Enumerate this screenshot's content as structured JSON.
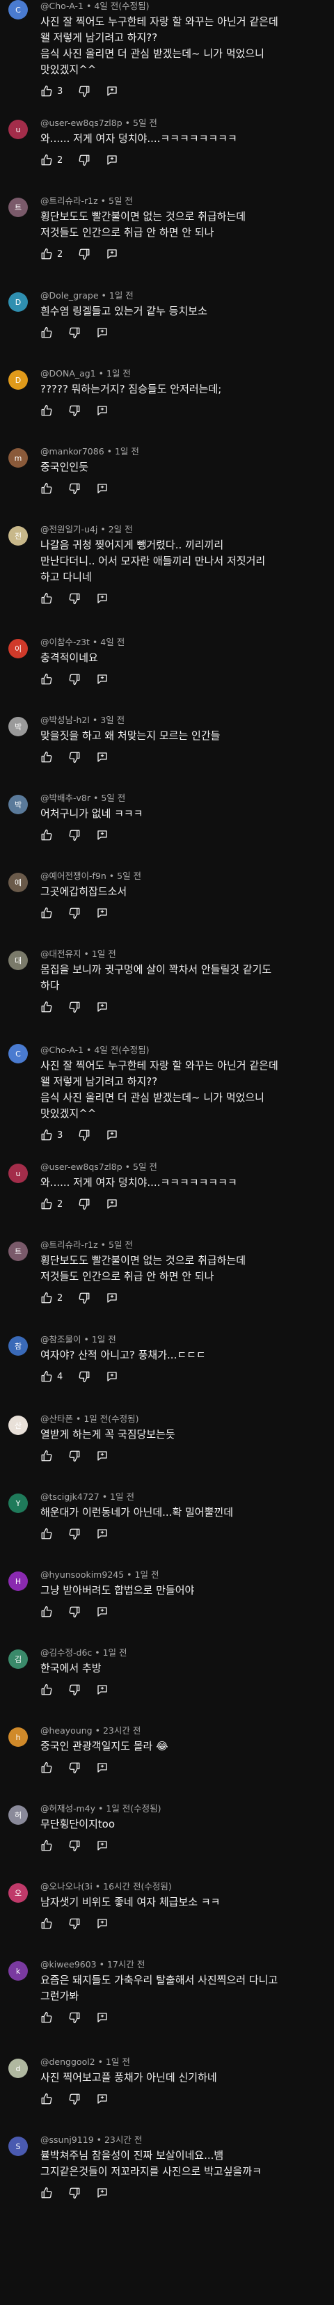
{
  "comments": [
    {
      "author": "@Cho-A-1",
      "time": "4일 전(수정됨)",
      "text": "사진 잘 찍어도 누구한테 자랑 할 와꾸는 아닌거 같은데\n왤 저렇게 남기려고 하지??\n음식 사진 올리면 더 관심 받겠는데~ 니가 먹었으니\n맛있겠지^^",
      "likes": "3",
      "avatar": {
        "color": "#4a7bd0",
        "glyph": "C"
      }
    },
    {
      "author": "@user-ew8qs7zl8p",
      "time": "5일 전",
      "text": "와...... 저게 여자 덩치야....ㅋㅋㅋㅋㅋㅋㅋㅋ",
      "likes": "2",
      "avatar": {
        "color": "#a32d4a",
        "glyph": "u"
      }
    },
    {
      "author": "@트리슈라-r1z",
      "time": "5일 전",
      "text": "횡단보도도 빨간불이면 없는 것으로 취급하는데\n저것들도 인간으로 취급 안 하면 안 되나",
      "likes": "2",
      "avatar": {
        "color": "#7a5a6a",
        "glyph": "트"
      }
    },
    {
      "author": "@Dole_grape",
      "time": "1일 전",
      "text": "흰수염 링겔들고 있는거 같누 등치보소",
      "likes": "",
      "avatar": {
        "color": "#2f8fb0",
        "glyph": "D"
      }
    },
    {
      "author": "@DONA_ag1",
      "time": "1일 전",
      "text": "????? 뭐하는거지? 짐승들도 안저러는데;",
      "likes": "",
      "avatar": {
        "color": "#e09a1a",
        "glyph": "D"
      }
    },
    {
      "author": "@mankor7086",
      "time": "1일 전",
      "text": "중국인인듯",
      "likes": "",
      "avatar": {
        "color": "#8a5a3a",
        "glyph": "m"
      }
    },
    {
      "author": "@전원일기-u4j",
      "time": "2일 전",
      "text": "나갈음 귀청 찢어지게 뺑거렸다.. 끼리끼리\n만난다더니.. 어서 모자란 애들끼리 만나서 저짓거리\n하고 다니네",
      "likes": "",
      "avatar": {
        "color": "#c8b88a",
        "glyph": "전"
      }
    },
    {
      "author": "@이참수-z3t",
      "time": "4일 전",
      "text": "충격적이네요",
      "likes": "",
      "avatar": {
        "color": "#d03a2a",
        "glyph": "이"
      }
    },
    {
      "author": "@박성남-h2l",
      "time": "3일 전",
      "text": "맞을짓을 하고 왜 처맞는지 모르는 인간들",
      "likes": "",
      "avatar": {
        "color": "#9a9a9a",
        "glyph": "박"
      }
    },
    {
      "author": "@박배추-v8r",
      "time": "5일 전",
      "text": "어처구니가 없네 ㅋㅋㅋ",
      "likes": "",
      "avatar": {
        "color": "#5a7a9a",
        "glyph": "박"
      }
    },
    {
      "author": "@예어전쟁이-f9n",
      "time": "5일 전",
      "text": "그곳에갑히잡드소서",
      "likes": "",
      "avatar": {
        "color": "#6a5a4a",
        "glyph": "예"
      }
    },
    {
      "author": "@대전유지",
      "time": "1일 전",
      "text": "몸집을 보니까 귓구멍에 살이 꽉차서 안들릴것 같기도\n하다",
      "likes": "",
      "avatar": {
        "color": "#7a7a6a",
        "glyph": "대"
      }
    },
    {
      "author": "@Cho-A-1",
      "time": "4일 전(수정됨)",
      "text": "사진 잘 찍어도 누구한테 자랑 할 와꾸는 아닌거 같은데\n왤 저렇게 남기려고 하지??\n음식 사진 올리면 더 관심 받겠는데~ 니가 먹었으니\n맛있겠지^^",
      "likes": "3",
      "avatar": {
        "color": "#4a7bd0",
        "glyph": "C"
      }
    },
    {
      "author": "@user-ew8qs7zl8p",
      "time": "5일 전",
      "text": "와...... 저게 여자 덩치야....ㅋㅋㅋㅋㅋㅋㅋㅋ",
      "likes": "2",
      "avatar": {
        "color": "#a32d4a",
        "glyph": "u"
      }
    },
    {
      "author": "@트리슈라-r1z",
      "time": "5일 전",
      "text": "횡단보도도 빨간불이면 없는 것으로 취급하는데\n저것들도 인간으로 취급 안 하면 안 되나",
      "likes": "2",
      "avatar": {
        "color": "#7a5a6a",
        "glyph": "트"
      }
    },
    {
      "author": "@참조물이",
      "time": "1일 전",
      "text": "여자야? 산적 아니고? 풍채가...ㄷㄷㄷ",
      "likes": "4",
      "avatar": {
        "color": "#3a6ab8",
        "glyph": "참"
      }
    },
    {
      "author": "@산타폰",
      "time": "1일 전(수정됨)",
      "text": "열받게 하는게 꼭 국짐당보는듯",
      "likes": "",
      "avatar": {
        "color": "#e8e0d8",
        "glyph": "산"
      }
    },
    {
      "author": "@tscigjk4727",
      "time": "1일 전",
      "text": "해운대가 이런동네가 아닌데...확 밀어뿔낀데",
      "likes": "",
      "avatar": {
        "color": "#1f7a5a",
        "glyph": "Y"
      }
    },
    {
      "author": "@hyunsookim9245",
      "time": "1일 전",
      "text": "그냥 받아버려도 합법으로 만들어야",
      "likes": "",
      "avatar": {
        "color": "#8a2ab0",
        "glyph": "H"
      }
    },
    {
      "author": "@김수정-d6c",
      "time": "1일 전",
      "text": "한국에서 추방",
      "likes": "",
      "avatar": {
        "color": "#3a8a6a",
        "glyph": "김"
      }
    },
    {
      "author": "@heayoung",
      "time": "23시간 전",
      "text": "중국인 관광객일지도 몰라 😂",
      "likes": "",
      "avatar": {
        "color": "#d08a2a",
        "glyph": "h"
      }
    },
    {
      "author": "@허재성-m4y",
      "time": "1일 전(수정됨)",
      "text": "무단횡단이지too",
      "likes": "",
      "avatar": {
        "color": "#8a8a9a",
        "glyph": "허"
      }
    },
    {
      "author": "@오나오나(3i",
      "time": "16시간 전(수정됨)",
      "text": "남자샛기 비위도 좋네 여자 체급보소 ㅋㅋ",
      "likes": "",
      "avatar": {
        "color": "#c03a6a",
        "glyph": "오"
      }
    },
    {
      "author": "@kiwee9603",
      "time": "17시간 전",
      "text": "요즘은 돼지들도 가축우리 탈출해서 사진찍으러 다니고\n그런가봐",
      "likes": "",
      "avatar": {
        "color": "#7a3aa0",
        "glyph": "k"
      }
    },
    {
      "author": "@denggool2",
      "time": "1일 전",
      "text": "사진 찍어보고플 풍채가 아닌데 신기하네",
      "likes": "",
      "avatar": {
        "color": "#b0b8a0",
        "glyph": "d"
      }
    },
    {
      "author": "@ssunj9119",
      "time": "23시간 전",
      "text": "뷸박쳐주님 참을성이 진짜 보살이네요...뱀\n그지같은것들이 저꼬라지를 사진으로 박고싶을까ㅋ",
      "likes": "",
      "avatar": {
        "color": "#4a5ab0",
        "glyph": "S"
      }
    }
  ]
}
